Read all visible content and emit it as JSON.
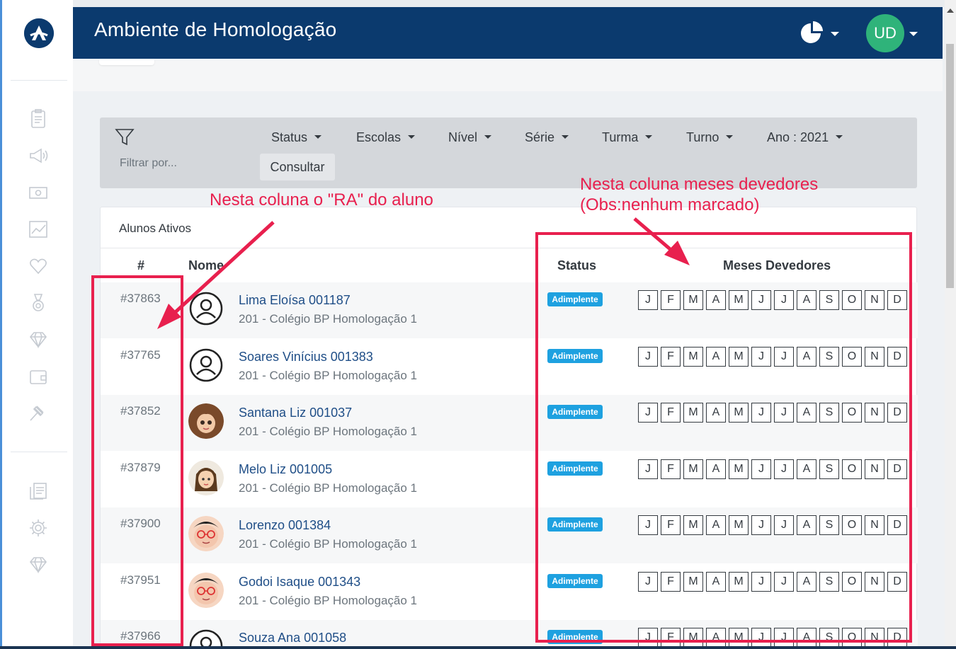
{
  "header": {
    "title": "Ambiente de Homologação",
    "user_initials": "UD",
    "colors": {
      "brand": "#0b3a6e",
      "avatar": "#2fb37a"
    }
  },
  "sidebar": {
    "icons": [
      "clipboard-icon",
      "megaphone-icon",
      "money-icon",
      "chart-icon",
      "heart-icon",
      "medal-icon",
      "diamond-icon",
      "wallet-icon",
      "gavel-icon",
      "reports-icon",
      "gear-icon",
      "diamond-icon"
    ]
  },
  "filters": {
    "filter_placeholder": "Filtrar por...",
    "dropdowns": [
      "Status",
      "Escolas",
      "Nível",
      "Série",
      "Turma",
      "Turno",
      "Ano : 2021"
    ],
    "consult_label": "Consultar"
  },
  "table": {
    "card_title": "Alunos Ativos",
    "headers": {
      "id": "#",
      "name": "Nome",
      "status": "Status",
      "months": "Meses Devedores"
    },
    "months": [
      "J",
      "F",
      "M",
      "A",
      "M",
      "J",
      "J",
      "A",
      "S",
      "O",
      "N",
      "D"
    ],
    "rows": [
      {
        "id": "#37863",
        "name": "Lima Eloísa 001187",
        "school": "201 - Colégio BP Homologação 1",
        "status": "Adimplente",
        "avatar": "default"
      },
      {
        "id": "#37765",
        "name": "Soares Vinícius 001383",
        "school": "201 - Colégio BP Homologação 1",
        "status": "Adimplente",
        "avatar": "default"
      },
      {
        "id": "#37852",
        "name": "Santana Liz 001037",
        "school": "201 - Colégio BP Homologação 1",
        "status": "Adimplente",
        "avatar": "girl1"
      },
      {
        "id": "#37879",
        "name": "Melo Liz 001005",
        "school": "201 - Colégio BP Homologação 1",
        "status": "Adimplente",
        "avatar": "girl2"
      },
      {
        "id": "#37900",
        "name": "Lorenzo 001384",
        "school": "201 - Colégio BP Homologação 1",
        "status": "Adimplente",
        "avatar": "boy"
      },
      {
        "id": "#37951",
        "name": "Godoi Isaque 001343",
        "school": "201 - Colégio BP Homologação 1",
        "status": "Adimplente",
        "avatar": "boy"
      },
      {
        "id": "#37966",
        "name": "Souza Ana 001058",
        "school": "",
        "status": "Adimplente",
        "avatar": "default"
      }
    ]
  },
  "annotations": {
    "ra_note": "Nesta  coluna o \"RA\" do aluno",
    "months_note_line1": "Nesta coluna  meses devedores",
    "months_note_line2": "(Obs:nenhum marcado)",
    "color": "#e8204e"
  }
}
